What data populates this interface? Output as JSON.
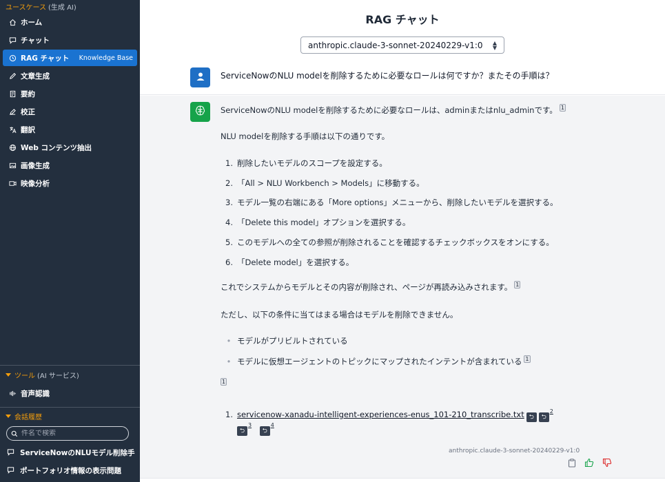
{
  "sidebar": {
    "usecase_head": "ユースケース",
    "usecase_sub": "(生成 AI)",
    "items": [
      {
        "label": "ホーム",
        "icon": "home-icon"
      },
      {
        "label": "チャット",
        "icon": "chat-icon"
      },
      {
        "label": "RAG チャット",
        "icon": "rag-icon",
        "badge": "Knowledge Base",
        "active": true
      },
      {
        "label": "文章生成",
        "icon": "pencil-icon"
      },
      {
        "label": "要約",
        "icon": "document-icon"
      },
      {
        "label": "校正",
        "icon": "edit-icon"
      },
      {
        "label": "翻訳",
        "icon": "translate-icon"
      },
      {
        "label": "Web コンテンツ抽出",
        "icon": "globe-icon"
      },
      {
        "label": "画像生成",
        "icon": "image-icon"
      },
      {
        "label": "映像分析",
        "icon": "video-icon"
      }
    ],
    "tools_head": "ツール",
    "tools_sub": "(AI サービス)",
    "tools_items": [
      {
        "label": "音声認識",
        "icon": "microphone-icon"
      }
    ],
    "history_head": "会話履歴",
    "search_placeholder": "件名で検索",
    "history_items": [
      {
        "label": "ServiceNowのNLUモデル削除手"
      },
      {
        "label": "ポートフォリオ情報の表示問題"
      }
    ]
  },
  "main": {
    "title": "RAG チャット",
    "model_selected": "anthropic.claude-3-sonnet-20240229-v1:0",
    "user_message": "ServiceNowのNLU modelを削除するために必要なロールは何ですか？またその手順は？",
    "answer": {
      "p1": "ServiceNowのNLU modelを削除するために必要なロールは、adminまたはnlu_adminです。",
      "p1_ref": "1",
      "p2": "NLU modelを削除する手順は以下の通りです。",
      "steps": [
        "削除したいモデルのスコープを設定する。",
        "「All > NLU Workbench > Models」に移動する。",
        "モデル一覧の右端にある「More options」メニューから、削除したいモデルを選択する。",
        "「Delete this model」オプションを選択する。",
        "このモデルへの全ての参照が削除されることを確認するチェックボックスをオンにする。",
        "「Delete model」を選択する。"
      ],
      "step_nums": [
        "1.",
        "2.",
        "3.",
        "4.",
        "5.",
        "6."
      ],
      "p3": "これでシステムからモデルとその内容が削除され、ページが再読み込みされます。",
      "p3_ref": "1",
      "p4": "ただし、以下の条件に当てはまる場合はモデルを削除できません。",
      "bullets": [
        "モデルがプリビルトされている",
        "モデルに仮想エージェントのトピックにマップされたインテントが含まれている"
      ],
      "bullet2_ref": "1",
      "ref_marker": "1",
      "ref_list_num": "1.",
      "ref_file": "servicenow-xanadu-intelligent-experiences-enus_101-210_transcribe.txt",
      "ref_page_a": "2",
      "ref_page_b": "3",
      "ref_page_c": "4",
      "ret_glyph": "⮌",
      "model_label": "anthropic.claude-3-sonnet-20240229-v1:0"
    }
  },
  "colors": {
    "sidebar_bg": "#232f3e",
    "active_bg": "#1a73d1",
    "section_accent": "#f59e0b",
    "user_avatar": "#1f6fc5",
    "bot_avatar": "#16a34a",
    "thumbs_up": "#16a34a",
    "thumbs_down": "#dc2626"
  }
}
